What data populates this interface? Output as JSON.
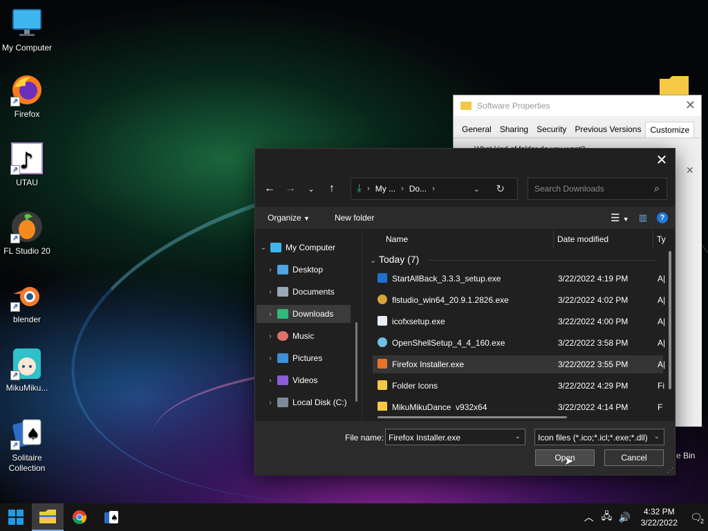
{
  "desktop": {
    "icons": [
      {
        "label": "My Computer"
      },
      {
        "label": "Firefox"
      },
      {
        "label": "UTAU"
      },
      {
        "label": "FL Studio 20"
      },
      {
        "label": "blender"
      },
      {
        "label": "MikuMiku..."
      },
      {
        "label": "Solitaire Collection"
      }
    ],
    "recycle_label": "e Bin"
  },
  "properties_window": {
    "title": "Software Properties",
    "tabs": [
      "General",
      "Sharing",
      "Security",
      "Previous Versions",
      "Customize"
    ],
    "active_tab": "Customize",
    "body_text": "What kind of folder do you want?"
  },
  "dialog": {
    "address": {
      "seg1": "My ...",
      "seg2": "Do..."
    },
    "search_placeholder": "Search Downloads",
    "toolbar": {
      "organize": "Organize",
      "new_folder": "New folder"
    },
    "nav": [
      {
        "label": "My Computer"
      },
      {
        "label": "Desktop"
      },
      {
        "label": "Documents"
      },
      {
        "label": "Downloads"
      },
      {
        "label": "Music"
      },
      {
        "label": "Pictures"
      },
      {
        "label": "Videos"
      },
      {
        "label": "Local Disk (C:)"
      }
    ],
    "columns": {
      "name": "Name",
      "date": "Date modified",
      "type": "Ty"
    },
    "group": "Today (7)",
    "files": [
      {
        "name": "StartAllBack_3.3.3_setup.exe",
        "date": "3/22/2022 4:19 PM",
        "type": "A|"
      },
      {
        "name": "flstudio_win64_20.9.1.2826.exe",
        "date": "3/22/2022 4:02 PM",
        "type": "A|"
      },
      {
        "name": "icofxsetup.exe",
        "date": "3/22/2022 4:00 PM",
        "type": "A|"
      },
      {
        "name": "OpenShellSetup_4_4_160.exe",
        "date": "3/22/2022 3:58 PM",
        "type": "A|"
      },
      {
        "name": "Firefox Installer.exe",
        "date": "3/22/2022 3:55 PM",
        "type": "A|"
      },
      {
        "name": "Folder Icons",
        "date": "3/22/2022 4:29 PM",
        "type": "Fi"
      },
      {
        "name": "MikuMikuDance_v932x64",
        "date": "3/22/2022 4:14 PM",
        "type": "Fi"
      }
    ],
    "file_name_label": "File name:",
    "file_name_value": "Firefox Installer.exe",
    "filter_value": "Icon files (*.ico;*.icl;*.exe;*.dll)",
    "open_label": "Open",
    "cancel_label": "Cancel"
  },
  "taskbar": {
    "time": "4:32 PM",
    "date": "3/22/2022",
    "notification_count": "2"
  }
}
